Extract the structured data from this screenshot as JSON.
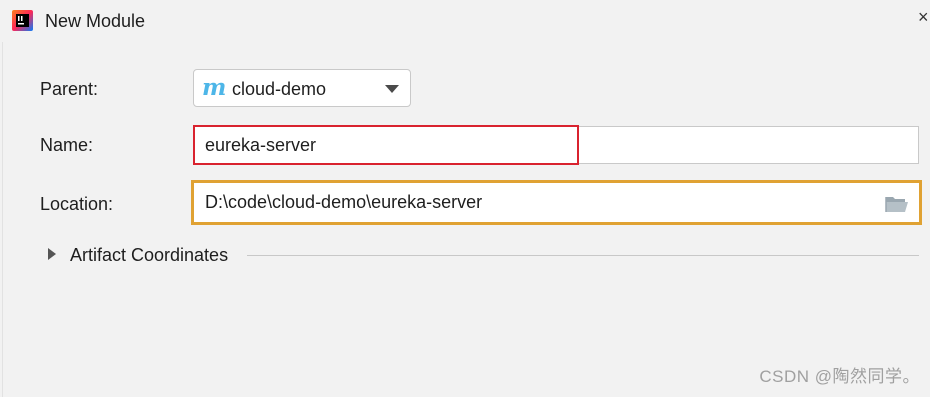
{
  "window": {
    "title": "New Module",
    "app_icon": "intellij-idea-icon",
    "close_glyph": "×"
  },
  "form": {
    "parent": {
      "label": "Parent:",
      "icon": "maven-module-icon",
      "icon_glyph": "m",
      "value": "cloud-demo"
    },
    "name": {
      "label": "Name:",
      "value": "eureka-server"
    },
    "location": {
      "label": "Location:",
      "value": "D:\\code\\cloud-demo\\eureka-server",
      "browse_icon": "folder-icon"
    },
    "artifact_section": {
      "label": "Artifact Coordinates",
      "expanded": false
    }
  },
  "watermark": "CSDN @陶然同学。",
  "colors": {
    "background": "#f2f2f2",
    "name_highlight": "#d9232f",
    "location_highlight": "#e0a233",
    "maven_icon": "#4db6e8"
  }
}
